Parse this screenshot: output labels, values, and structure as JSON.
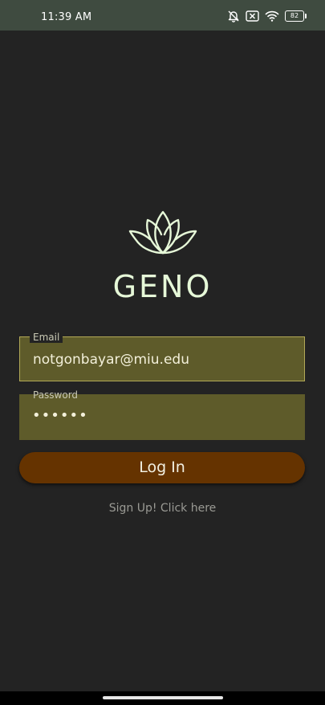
{
  "status_bar": {
    "time": "11:39 AM",
    "battery": "82",
    "icons": [
      "bell-muted-icon",
      "sim-off-icon",
      "wifi-icon",
      "battery-icon"
    ]
  },
  "app": {
    "title": "GENO",
    "logo": "lotus-icon"
  },
  "form": {
    "email": {
      "label": "Email",
      "value": "notgonbayar@miu.edu"
    },
    "password": {
      "label": "Password",
      "value": "••••••"
    },
    "login_label": "Log In",
    "signup_text": "Sign Up! Click here"
  },
  "colors": {
    "background": "#232323",
    "status_bar": "#3f4b40",
    "field": "#5e5b2a",
    "field_border": "#b2a957",
    "button": "#653300",
    "accent": "#e6f8d8"
  }
}
